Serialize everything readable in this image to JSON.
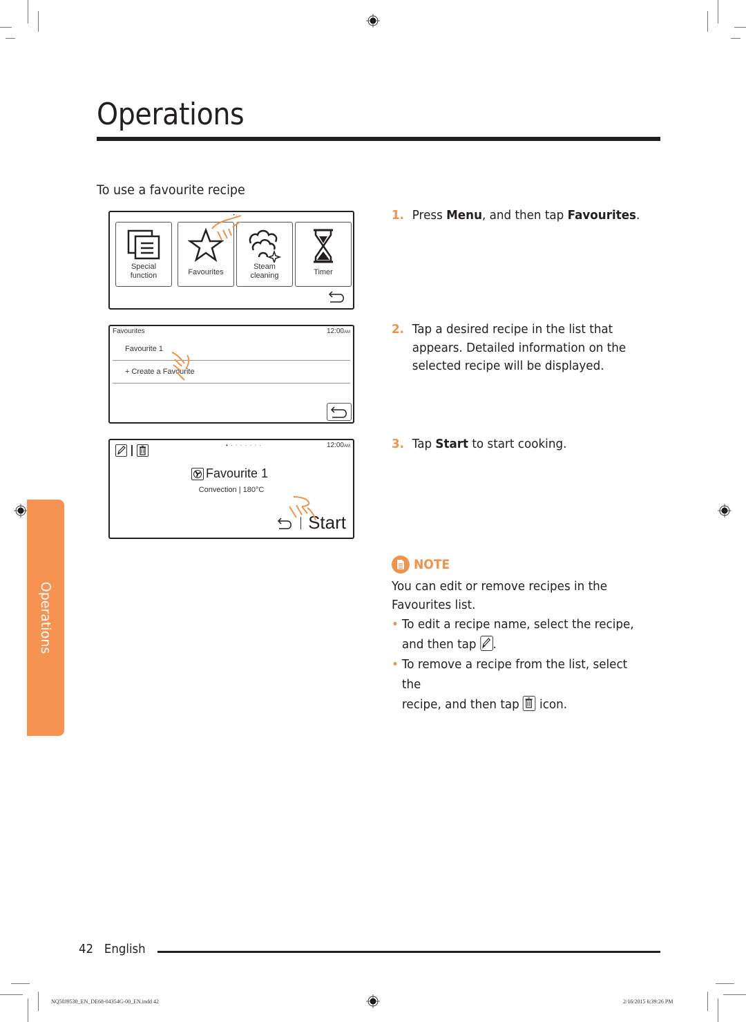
{
  "page": {
    "title": "Operations",
    "section_heading": "To use a favourite recipe",
    "side_tab": "Operations",
    "page_number": "42",
    "language": "English",
    "slug_file": "NQ50J9530_EN_DE68-04354G-00_EN.indd   42",
    "slug_date": "2/16/2015   6:39:26 PM"
  },
  "screen1": {
    "tiles": [
      {
        "label": "Special\nfunction",
        "icon": "special-function-icon"
      },
      {
        "label": "Favourites",
        "icon": "star-icon"
      },
      {
        "label": "Steam\ncleaning",
        "icon": "steam-cleaning-icon"
      },
      {
        "label": "Timer",
        "icon": "hourglass-icon"
      }
    ],
    "tile_labels": [
      "Special function",
      "Favourites",
      "Steam cleaning",
      "Timer"
    ]
  },
  "screen2": {
    "header": "Favourites",
    "clock_time": "12:00",
    "clock_ampm": "AM",
    "items": [
      "Favourite 1",
      "+  Create a Favourite"
    ]
  },
  "screen3": {
    "clock_time": "12:00",
    "clock_ampm": "AM",
    "page_dots": "• · · · · · · ·",
    "recipe_name": "Favourite 1",
    "recipe_details": "Convection | 180°C",
    "start_label": "Start"
  },
  "steps": [
    {
      "num": "1.",
      "pre": "Press ",
      "b1": "Menu",
      "mid": ", and then tap ",
      "b2": "Favourites",
      "post": "."
    },
    {
      "num": "2.",
      "text": "Tap a desired recipe in the list that appears. Detailed information on the selected recipe will be displayed."
    },
    {
      "num": "3.",
      "pre": "Tap ",
      "b1": "Start",
      "post": " to start cooking."
    }
  ],
  "note": {
    "label": "NOTE",
    "intro": "You can edit or remove recipes in the Favourites list.",
    "bullet1_a": "To edit a recipe name, select the recipe,",
    "bullet1_b": "and then tap",
    "bullet1_c": ".",
    "bullet2_a": "To remove a recipe from the list, select the",
    "bullet2_b": "recipe, and then tap",
    "bullet2_c": "icon."
  },
  "colors": {
    "accent": "#f0924a",
    "side_tab": "#f69352",
    "text": "#231f20"
  }
}
